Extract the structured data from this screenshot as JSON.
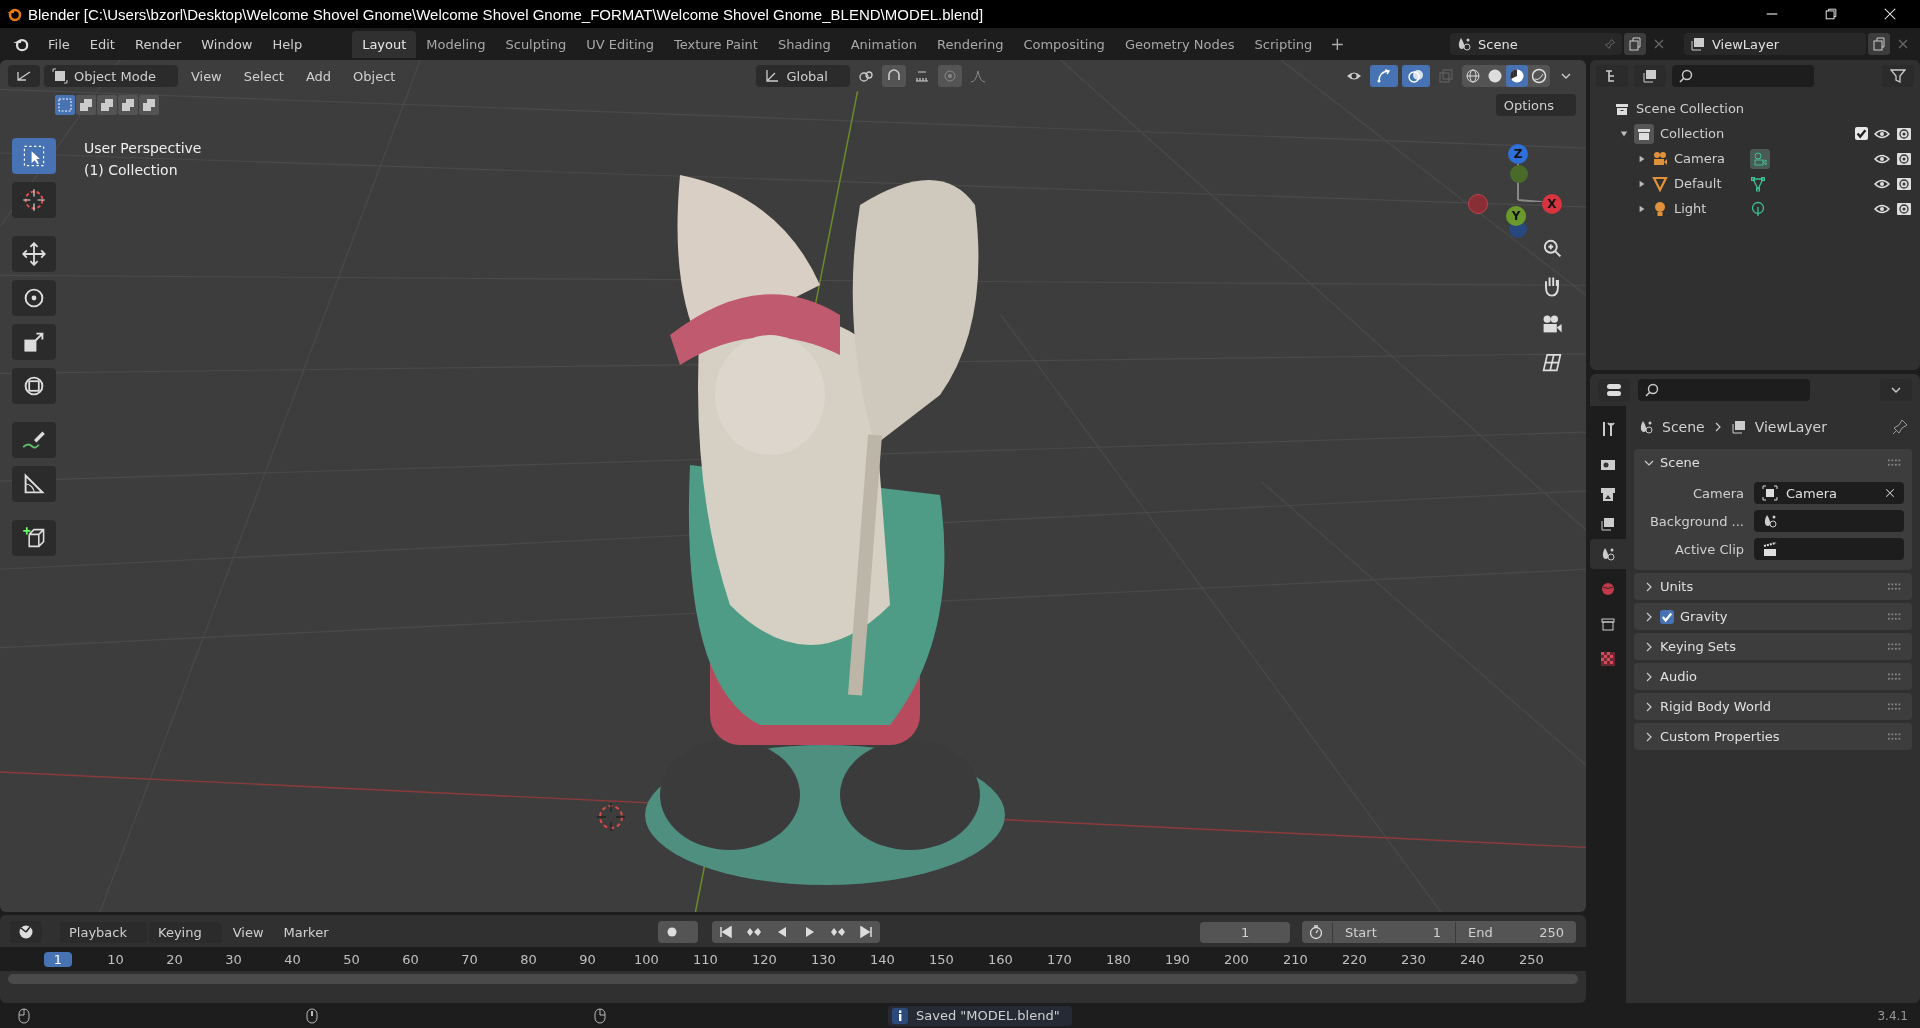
{
  "window": {
    "title": "Blender [C:\\Users\\bzorl\\Desktop\\Welcome Shovel Gnome\\Welcome Shovel Gnome_FORMAT\\Welcome Shovel Gnome_BLEND\\MODEL.blend]"
  },
  "menu": [
    "File",
    "Edit",
    "Render",
    "Window",
    "Help"
  ],
  "workspaces": [
    {
      "label": "Layout",
      "selected": true
    },
    {
      "label": "Modeling",
      "selected": false
    },
    {
      "label": "Sculpting",
      "selected": false
    },
    {
      "label": "UV Editing",
      "selected": false
    },
    {
      "label": "Texture Paint",
      "selected": false
    },
    {
      "label": "Shading",
      "selected": false
    },
    {
      "label": "Animation",
      "selected": false
    },
    {
      "label": "Rendering",
      "selected": false
    },
    {
      "label": "Compositing",
      "selected": false
    },
    {
      "label": "Geometry Nodes",
      "selected": false
    },
    {
      "label": "Scripting",
      "selected": false
    }
  ],
  "add_workspace": "+",
  "scene": "Scene",
  "view_layer": "ViewLayer",
  "viewport": {
    "mode": "Object Mode",
    "menus": [
      "View",
      "Select",
      "Add",
      "Object"
    ],
    "orientation": "Global",
    "select_modes": [
      {
        "selected": true
      },
      {
        "selected": false
      },
      {
        "selected": false
      },
      {
        "selected": false
      },
      {
        "selected": false
      }
    ],
    "toggles": [
      {
        "kind": "gizmo",
        "on": true
      },
      {
        "kind": "overlay",
        "on": true
      }
    ],
    "shading": [
      {
        "kind": "wireframe",
        "selected": false
      },
      {
        "kind": "solid",
        "selected": false
      },
      {
        "kind": "material",
        "selected": true
      },
      {
        "kind": "rendered",
        "selected": false
      }
    ],
    "options": "Options",
    "view_name": "User Perspective",
    "collection": "(1) Collection",
    "gizmo_axes": [
      {
        "label": "Z",
        "color": "#2e6fd8"
      },
      {
        "label": "Y",
        "color": "#6a9a2a"
      },
      {
        "label": "X",
        "color": "#d8343f"
      }
    ],
    "tools": [
      {
        "kind": "select",
        "selected": true
      },
      {
        "kind": "cursor",
        "selected": false
      },
      {
        "kind": "move",
        "selected": false
      },
      {
        "kind": "rotate",
        "selected": false
      },
      {
        "kind": "scale",
        "selected": false
      },
      {
        "kind": "transform",
        "selected": false
      },
      {
        "kind": "annotate",
        "selected": false
      },
      {
        "kind": "measure",
        "selected": false
      },
      {
        "kind": "add",
        "selected": false
      }
    ]
  },
  "outliner": {
    "root": "Scene Collection",
    "children": [
      {
        "name": "Collection",
        "kind": "collection",
        "checked": true,
        "expanded": true,
        "children": [
          {
            "name": "Camera",
            "kind": "camera",
            "expanded": false
          },
          {
            "name": "Default",
            "kind": "mesh",
            "expanded": false
          },
          {
            "name": "Light",
            "kind": "light",
            "expanded": false
          }
        ]
      }
    ]
  },
  "properties": {
    "tabs": [
      {
        "kind": "tool",
        "selected": false
      },
      {
        "kind": "render",
        "selected": false
      },
      {
        "kind": "output",
        "selected": false
      },
      {
        "kind": "view_layer",
        "selected": false
      },
      {
        "kind": "scene",
        "selected": true
      },
      {
        "kind": "world",
        "selected": false
      },
      {
        "kind": "collection",
        "selected": false
      },
      {
        "kind": "texture",
        "selected": false
      }
    ],
    "breadcrumb": [
      "Scene",
      "ViewLayer"
    ],
    "panels": [
      {
        "title": "Scene",
        "expanded": true,
        "fields": [
          {
            "label": "Camera",
            "kind": "camera",
            "value": "Camera"
          },
          {
            "label": "Background ...",
            "kind": "scene"
          },
          {
            "label": "Active Clip",
            "kind": "clip"
          }
        ]
      },
      {
        "title": "Units",
        "expanded": false
      },
      {
        "title": "Gravity",
        "expanded": false,
        "checked": true
      },
      {
        "title": "Keying Sets",
        "expanded": false
      },
      {
        "title": "Audio",
        "expanded": false
      },
      {
        "title": "Rigid Body World",
        "expanded": false
      },
      {
        "title": "Custom Properties",
        "expanded": false
      }
    ]
  },
  "timeline": {
    "menus": [
      "Playback",
      "Keying",
      "View",
      "Marker"
    ],
    "current_frame": "1",
    "start_label": "Start",
    "start": "1",
    "end_label": "End",
    "end": "250",
    "ruler": [
      {
        "label": "1",
        "selected": true
      },
      {
        "label": "10",
        "selected": false
      },
      {
        "label": "20",
        "selected": false
      },
      {
        "label": "30",
        "selected": false
      },
      {
        "label": "40",
        "selected": false
      },
      {
        "label": "50",
        "selected": false
      },
      {
        "label": "60",
        "selected": false
      },
      {
        "label": "70",
        "selected": false
      },
      {
        "label": "80",
        "selected": false
      },
      {
        "label": "90",
        "selected": false
      },
      {
        "label": "100",
        "selected": false
      },
      {
        "label": "110",
        "selected": false
      },
      {
        "label": "120",
        "selected": false
      },
      {
        "label": "130",
        "selected": false
      },
      {
        "label": "140",
        "selected": false
      },
      {
        "label": "150",
        "selected": false
      },
      {
        "label": "160",
        "selected": false
      },
      {
        "label": "170",
        "selected": false
      },
      {
        "label": "180",
        "selected": false
      },
      {
        "label": "190",
        "selected": false
      },
      {
        "label": "200",
        "selected": false
      },
      {
        "label": "210",
        "selected": false
      },
      {
        "label": "220",
        "selected": false
      },
      {
        "label": "230",
        "selected": false
      },
      {
        "label": "240",
        "selected": false
      },
      {
        "label": "250",
        "selected": false
      }
    ]
  },
  "status": {
    "message": "Saved \"MODEL.blend\"",
    "version": "3.4.1"
  }
}
